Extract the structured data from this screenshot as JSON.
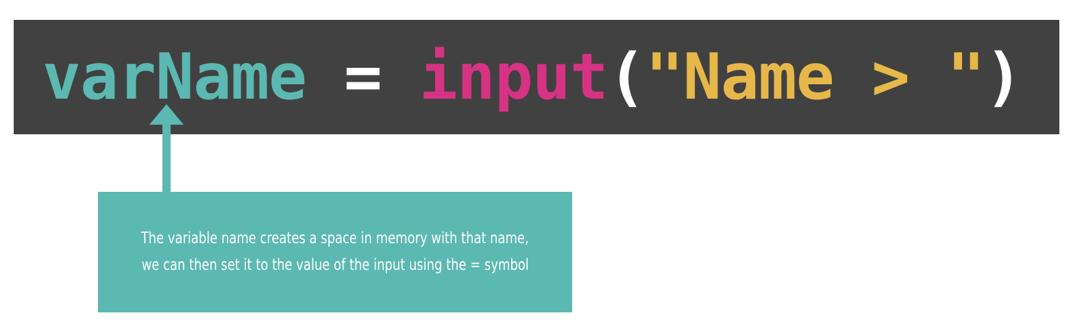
{
  "code": {
    "tokens": {
      "variable": "varName",
      "assign": " = ",
      "function": "input",
      "open_paren": "(",
      "string": "\"Name > \"",
      "close_paren": ")"
    },
    "colors": {
      "background": "#414141",
      "variable": "#5bb9b2",
      "operator": "#ffffff",
      "function": "#d63384",
      "string": "#e6b84a"
    }
  },
  "callout": {
    "line1": "The variable name creates a space in memory with that name,",
    "line2": "we can then set it to the value of the input using the = symbol",
    "color": "#5bb9b2"
  }
}
